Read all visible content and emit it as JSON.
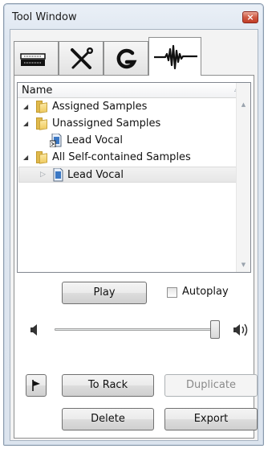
{
  "window": {
    "title": "Tool Window",
    "close_glyph": "×"
  },
  "tabs": [
    {
      "icon": "rack-icon",
      "active": false
    },
    {
      "icon": "tools-icon",
      "active": false
    },
    {
      "icon": "g-logo-icon",
      "active": false
    },
    {
      "icon": "waveform-icon",
      "active": true
    }
  ],
  "tree": {
    "header": "Name",
    "nodes": [
      {
        "label": "Assigned Samples",
        "type": "folder",
        "expanded": true
      },
      {
        "label": "Unassigned Samples",
        "type": "folder",
        "expanded": true
      },
      {
        "label": "Lead Vocal",
        "type": "sample"
      },
      {
        "label": "All Self-contained Samples",
        "type": "folder",
        "expanded": true
      },
      {
        "label": "Lead Vocal",
        "type": "sample",
        "selected": true,
        "expander": "collapsed"
      }
    ]
  },
  "controls": {
    "play_label": "Play",
    "autoplay_label": "Autoplay",
    "autoplay_checked": false,
    "volume_level": 0.98,
    "to_rack_label": "To Rack",
    "duplicate_label": "Duplicate",
    "delete_label": "Delete",
    "export_label": "Export"
  },
  "colors": {
    "accent_close": "#c13d27",
    "selection": "#e6e6e6"
  }
}
